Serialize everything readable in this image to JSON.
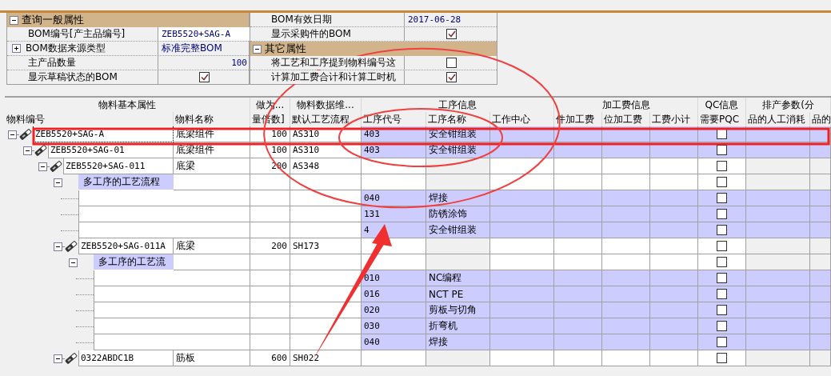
{
  "property_panels": [
    {
      "sections": [
        {
          "title": "查询一般属性",
          "expanded": true,
          "rows": [
            {
              "kind": "text",
              "label": "BOM编号[产主品编号]",
              "value": "ZEB5520+SAG-A",
              "selected": true
            },
            {
              "kind": "text",
              "label": "BOM数据来源类型",
              "value": "标准完整BOM",
              "expanded": false,
              "selected": false
            },
            {
              "kind": "number",
              "label": "主产品数量",
              "value": "100",
              "selected": false
            },
            {
              "kind": "check",
              "label": "显示草稿状态的BOM",
              "checked": true,
              "selected": false
            }
          ]
        }
      ]
    },
    {
      "sections": [
        {
          "rows": [
            {
              "kind": "text",
              "label": "BOM有效日期",
              "value": "2017-06-28",
              "selected": false
            },
            {
              "kind": "check",
              "label": "显示采购件的BOM",
              "checked": true,
              "selected": false
            }
          ]
        },
        {
          "title": "其它属性",
          "expanded": true,
          "rows": [
            {
              "kind": "check",
              "label": "将工艺和工序提到物料编号这",
              "checked": false,
              "selected": false
            },
            {
              "kind": "check",
              "label": "计算加工费合计和计算工时机",
              "checked": true,
              "selected": false
            }
          ]
        }
      ]
    }
  ],
  "grid": {
    "column_groups": [
      {
        "label": "物料基本属性",
        "columns": [
          "物料编号",
          "物料名称"
        ]
      },
      {
        "label": "做为...",
        "columns": [
          "量倍数]"
        ]
      },
      {
        "label": "物料数据维...",
        "columns": [
          "默认工艺流程"
        ]
      },
      {
        "label": "工序信息",
        "columns": [
          "工序代号",
          "工序名称",
          "工作中心"
        ]
      },
      {
        "label": "加工费信息",
        "columns": [
          "件加工费",
          "位加工费",
          "工费小计"
        ]
      },
      {
        "label": "QC信息",
        "columns": [
          "需要PQC"
        ]
      },
      {
        "label": "排产参数(分",
        "columns": [
          "品的人工消耗",
          "品的"
        ]
      }
    ],
    "rows": [
      {
        "kind": "item",
        "code": "ZEB5520+SAG-A",
        "name": "底梁组件",
        "qty": "100",
        "route": "AS310",
        "op_code": "403",
        "op_name": "安全钳组装",
        "pqc": false,
        "selected": true,
        "expanded": true,
        "children": [
          {
            "kind": "item",
            "code": "ZEB5520+SAG-01",
            "name": "底梁组件",
            "qty": "100",
            "route": "AS310",
            "op_code": "403",
            "op_name": "安全钳组装",
            "pqc": false,
            "selected": false,
            "expanded": true,
            "children": [
              {
                "kind": "item",
                "code": "ZEB5520+SAG-011",
                "name": "底梁",
                "qty": "200",
                "route": "AS348",
                "pqc": false,
                "selected": false,
                "expanded": true,
                "children": [
                  {
                    "kind": "route",
                    "label": "多工序的工艺流程",
                    "pqc": false,
                    "selected": false,
                    "expanded": true,
                    "children": [
                      {
                        "kind": "op",
                        "op_code": "040",
                        "op_name": "焊接",
                        "pqc": false,
                        "selected": false
                      },
                      {
                        "kind": "op",
                        "op_code": "131",
                        "op_name": "防锈涂饰",
                        "pqc": false,
                        "selected": false
                      },
                      {
                        "kind": "op",
                        "op_code": "4",
                        "op_name": "安全钳组装",
                        "pqc": false,
                        "selected": false
                      }
                    ]
                  },
                  {
                    "kind": "item",
                    "code": "ZEB5520+SAG-011A",
                    "name": "底梁",
                    "qty": "200",
                    "route": "SH173",
                    "pqc": false,
                    "selected": false,
                    "expanded": true,
                    "children": [
                      {
                        "kind": "route",
                        "label": "多工序的工艺流",
                        "pqc": false,
                        "selected": false,
                        "expanded": true,
                        "children": [
                          {
                            "kind": "op",
                            "op_code": "010",
                            "op_name": "NC编程",
                            "pqc": false,
                            "selected": false
                          },
                          {
                            "kind": "op",
                            "op_code": "016",
                            "op_name": "NCT PE",
                            "pqc": false,
                            "selected": false
                          },
                          {
                            "kind": "op",
                            "op_code": "020",
                            "op_name": "剪板与切角",
                            "pqc": false,
                            "selected": false
                          },
                          {
                            "kind": "op",
                            "op_code": "030",
                            "op_name": "折弯机",
                            "pqc": false,
                            "selected": false
                          },
                          {
                            "kind": "op",
                            "op_code": "040",
                            "op_name": "焊接",
                            "pqc": false,
                            "selected": false
                          }
                        ]
                      }
                    ]
                  },
                  {
                    "kind": "item",
                    "code": "0322ABDC1B",
                    "name": "筋板",
                    "qty": "600",
                    "route": "SH022",
                    "pqc": false,
                    "selected": false,
                    "expanded": true
                  }
                ]
              }
            ]
          }
        ]
      }
    ]
  },
  "annotations": [
    {
      "kind": "rectangle"
    },
    {
      "kind": "ellipse"
    },
    {
      "kind": "ellipse"
    },
    {
      "kind": "arrow"
    }
  ]
}
